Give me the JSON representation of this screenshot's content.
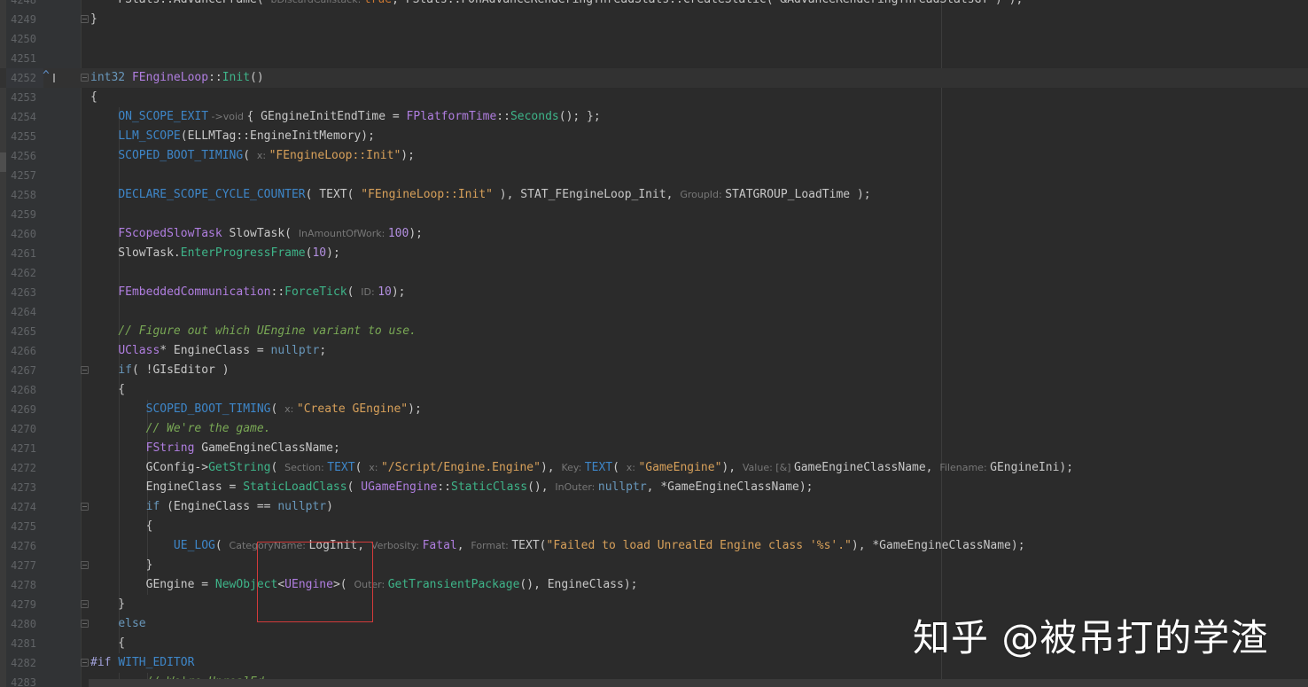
{
  "editor": {
    "watermark": "知乎 @被吊打的学渣",
    "lines": [
      {
        "n": "4248",
        "segs": [
          [
            "pl",
            "    FStats::AdvanceFrame( "
          ],
          [
            "hint",
            "bDiscardCallstack: "
          ],
          [
            "kw",
            "true"
          ],
          [
            "pl",
            ", FStats::FOnAdvanceRenderingThreadStats::CreateStatic( &AdvanceRenderingThreadStatsGT ) );"
          ]
        ]
      },
      {
        "n": "4249",
        "fold": true,
        "segs": [
          [
            "pl",
            "}"
          ]
        ]
      },
      {
        "n": "4250",
        "segs": []
      },
      {
        "n": "4251",
        "segs": []
      },
      {
        "n": "4252",
        "current": true,
        "fold": true,
        "marker": "^",
        "segs": [
          [
            "kwb",
            "int32 "
          ],
          [
            "typ",
            "FEngineLoop"
          ],
          [
            "pl",
            "::"
          ],
          [
            "mfn",
            "Init"
          ],
          [
            "pl",
            "()"
          ]
        ]
      },
      {
        "n": "4253",
        "segs": [
          [
            "pl",
            "{"
          ]
        ]
      },
      {
        "n": "4254",
        "guides": 1,
        "segs": [
          [
            "pl",
            "    "
          ],
          [
            "mac",
            "ON_SCOPE_EXIT"
          ],
          [
            "hint",
            " ->void "
          ],
          [
            "pl",
            "{ GEngineInitEndTime = "
          ],
          [
            "typ",
            "FPlatformTime"
          ],
          [
            "pl",
            "::"
          ],
          [
            "mfn",
            "Seconds"
          ],
          [
            "pl",
            "(); };"
          ]
        ]
      },
      {
        "n": "4255",
        "guides": 1,
        "segs": [
          [
            "pl",
            "    "
          ],
          [
            "mac",
            "LLM_SCOPE"
          ],
          [
            "pl",
            "(ELLMTag::EngineInitMemory);"
          ]
        ]
      },
      {
        "n": "4256",
        "guides": 1,
        "segs": [
          [
            "pl",
            "    "
          ],
          [
            "mac",
            "SCOPED_BOOT_TIMING"
          ],
          [
            "pl",
            "( "
          ],
          [
            "hint",
            "x: "
          ],
          [
            "str",
            "\"FEngineLoop::Init\""
          ],
          [
            "pl",
            ");"
          ]
        ]
      },
      {
        "n": "4257",
        "guides": 1,
        "segs": []
      },
      {
        "n": "4258",
        "guides": 1,
        "segs": [
          [
            "pl",
            "    "
          ],
          [
            "mac",
            "DECLARE_SCOPE_CYCLE_COUNTER"
          ],
          [
            "pl",
            "( TEXT( "
          ],
          [
            "str",
            "\"FEngineLoop::Init\""
          ],
          [
            "pl",
            " ), STAT_FEngineLoop_Init, "
          ],
          [
            "hint",
            "GroupId: "
          ],
          [
            "pl",
            "STATGROUP_LoadTime );"
          ]
        ]
      },
      {
        "n": "4259",
        "guides": 1,
        "segs": []
      },
      {
        "n": "4260",
        "guides": 1,
        "segs": [
          [
            "pl",
            "    "
          ],
          [
            "typ",
            "FScopedSlowTask"
          ],
          [
            "pl",
            " SlowTask( "
          ],
          [
            "hint",
            "InAmountOfWork: "
          ],
          [
            "num",
            "100"
          ],
          [
            "pl",
            ");"
          ]
        ]
      },
      {
        "n": "4261",
        "guides": 1,
        "segs": [
          [
            "pl",
            "    SlowTask."
          ],
          [
            "mfn",
            "EnterProgressFrame"
          ],
          [
            "pl",
            "("
          ],
          [
            "num",
            "10"
          ],
          [
            "pl",
            ");"
          ]
        ]
      },
      {
        "n": "4262",
        "guides": 1,
        "segs": []
      },
      {
        "n": "4263",
        "guides": 1,
        "segs": [
          [
            "pl",
            "    "
          ],
          [
            "typ",
            "FEmbeddedCommunication"
          ],
          [
            "pl",
            "::"
          ],
          [
            "mfn",
            "ForceTick"
          ],
          [
            "pl",
            "( "
          ],
          [
            "hint",
            "ID: "
          ],
          [
            "num",
            "10"
          ],
          [
            "pl",
            ");"
          ]
        ]
      },
      {
        "n": "4264",
        "guides": 1,
        "segs": []
      },
      {
        "n": "4265",
        "guides": 1,
        "segs": [
          [
            "pl",
            "    "
          ],
          [
            "cmt",
            "// Figure out which UEngine variant to use."
          ]
        ]
      },
      {
        "n": "4266",
        "guides": 1,
        "segs": [
          [
            "pl",
            "    "
          ],
          [
            "typ",
            "UClass"
          ],
          [
            "pl",
            "* EngineClass = "
          ],
          [
            "kwb",
            "nullptr"
          ],
          [
            "pl",
            ";"
          ]
        ]
      },
      {
        "n": "4267",
        "guides": 1,
        "fold": true,
        "segs": [
          [
            "pl",
            "    "
          ],
          [
            "kwb",
            "if"
          ],
          [
            "pl",
            "( !GIsEditor )"
          ]
        ]
      },
      {
        "n": "4268",
        "guides": 1,
        "segs": [
          [
            "pl",
            "    {"
          ]
        ]
      },
      {
        "n": "4269",
        "guides": 2,
        "segs": [
          [
            "pl",
            "        "
          ],
          [
            "mac",
            "SCOPED_BOOT_TIMING"
          ],
          [
            "pl",
            "( "
          ],
          [
            "hint",
            "x: "
          ],
          [
            "str",
            "\"Create GEngine\""
          ],
          [
            "pl",
            ");"
          ]
        ]
      },
      {
        "n": "4270",
        "guides": 2,
        "segs": [
          [
            "pl",
            "        "
          ],
          [
            "cmt",
            "// We're the game."
          ]
        ]
      },
      {
        "n": "4271",
        "guides": 2,
        "segs": [
          [
            "pl",
            "        "
          ],
          [
            "typ",
            "FString"
          ],
          [
            "pl",
            " GameEngineClassName;"
          ]
        ]
      },
      {
        "n": "4272",
        "guides": 2,
        "segs": [
          [
            "pl",
            "        GConfig->"
          ],
          [
            "mfn",
            "GetString"
          ],
          [
            "pl",
            "( "
          ],
          [
            "hint",
            "Section: "
          ],
          [
            "mac",
            "TEXT"
          ],
          [
            "pl",
            "( "
          ],
          [
            "hint",
            "x: "
          ],
          [
            "str",
            "\"/Script/Engine.Engine\""
          ],
          [
            "pl",
            "), "
          ],
          [
            "hint",
            "Key: "
          ],
          [
            "mac",
            "TEXT"
          ],
          [
            "pl",
            "( "
          ],
          [
            "hint",
            "x: "
          ],
          [
            "str",
            "\"GameEngine\""
          ],
          [
            "pl",
            "), "
          ],
          [
            "hint",
            "Value: [&] "
          ],
          [
            "pl",
            "GameEngineClassName, "
          ],
          [
            "hint",
            "Filename: "
          ],
          [
            "pl",
            "GEngineIni);"
          ]
        ]
      },
      {
        "n": "4273",
        "guides": 2,
        "segs": [
          [
            "pl",
            "        EngineClass = "
          ],
          [
            "mfn",
            "StaticLoadClass"
          ],
          [
            "pl",
            "( "
          ],
          [
            "typ",
            "UGameEngine"
          ],
          [
            "pl",
            "::"
          ],
          [
            "mfn",
            "StaticClass"
          ],
          [
            "pl",
            "(), "
          ],
          [
            "hint",
            "InOuter: "
          ],
          [
            "kwb",
            "nullptr"
          ],
          [
            "pl",
            ", *GameEngineClassName);"
          ]
        ]
      },
      {
        "n": "4274",
        "guides": 2,
        "fold": true,
        "segs": [
          [
            "pl",
            "        "
          ],
          [
            "kwb",
            "if"
          ],
          [
            "pl",
            " (EngineClass == "
          ],
          [
            "kwb",
            "nullptr"
          ],
          [
            "pl",
            ")"
          ]
        ]
      },
      {
        "n": "4275",
        "guides": 2,
        "segs": [
          [
            "pl",
            "        {"
          ]
        ]
      },
      {
        "n": "4276",
        "guides": 2,
        "segs": [
          [
            "pl",
            "            "
          ],
          [
            "mac",
            "UE_LOG"
          ],
          [
            "pl",
            "( "
          ],
          [
            "hint",
            "CategoryName: "
          ],
          [
            "pl",
            "LogInit, "
          ],
          [
            "hint",
            "Verbosity: "
          ],
          [
            "typ",
            "Fatal"
          ],
          [
            "pl",
            ", "
          ],
          [
            "hint",
            "Format: "
          ],
          [
            "pl",
            "TEXT("
          ],
          [
            "str",
            "\"Failed to load UnrealEd Engine class '%s'.\""
          ],
          [
            "pl",
            "), *GameEngineClassName);"
          ]
        ]
      },
      {
        "n": "4277",
        "guides": 2,
        "fold": true,
        "segs": [
          [
            "pl",
            "        }"
          ]
        ]
      },
      {
        "n": "4278",
        "guides": 2,
        "segs": [
          [
            "pl",
            "        GEngine = "
          ],
          [
            "mfn",
            "NewObject"
          ],
          [
            "pl",
            "<"
          ],
          [
            "typ",
            "UEngine"
          ],
          [
            "pl",
            ">( "
          ],
          [
            "hint",
            "Outer: "
          ],
          [
            "mfn",
            "GetTransientPackage"
          ],
          [
            "pl",
            "(), EngineClass);"
          ]
        ]
      },
      {
        "n": "4279",
        "guides": 1,
        "fold": true,
        "segs": [
          [
            "pl",
            "    }"
          ]
        ]
      },
      {
        "n": "4280",
        "guides": 1,
        "fold": true,
        "segs": [
          [
            "pl",
            "    "
          ],
          [
            "kwb",
            "else"
          ]
        ]
      },
      {
        "n": "4281",
        "guides": 1,
        "segs": [
          [
            "pl",
            "    {"
          ]
        ]
      },
      {
        "n": "4282",
        "fold": true,
        "segs": [
          [
            "pp",
            "#if "
          ],
          [
            "mac",
            "WITH_EDITOR"
          ]
        ]
      },
      {
        "n": "4283",
        "guides": 2,
        "segs": [
          [
            "pl",
            "        "
          ],
          [
            "cmt",
            "// We're UnrealEd."
          ]
        ]
      }
    ]
  }
}
